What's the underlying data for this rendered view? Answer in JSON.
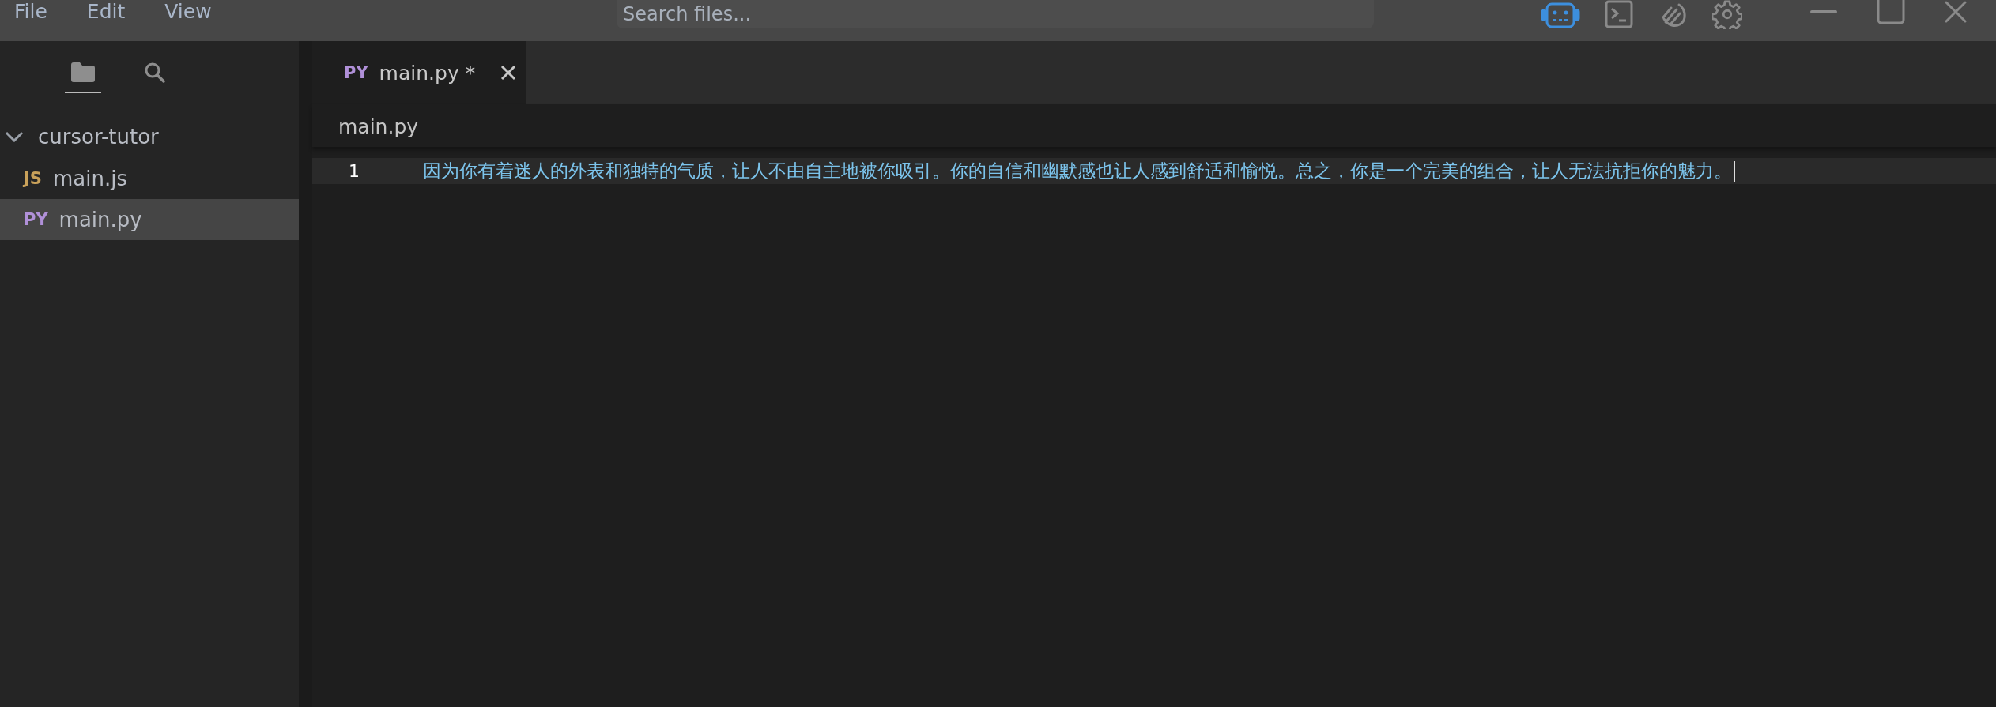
{
  "menu": [
    {
      "label": "File"
    },
    {
      "label": "Edit"
    },
    {
      "label": "View"
    }
  ],
  "search": {
    "placeholder": "Search files..."
  },
  "toolbar": [
    {
      "kind": "robot",
      "active": true
    },
    {
      "kind": "terminal",
      "active": false
    },
    {
      "kind": "wave",
      "active": false
    },
    {
      "kind": "settings",
      "active": false
    }
  ],
  "sidebar": {
    "views": [
      {
        "kind": "files",
        "selected": true
      },
      {
        "kind": "search",
        "selected": false
      }
    ],
    "tree": [
      {
        "label": "cursor-tutor",
        "expanded": true,
        "children": [
          {
            "badge": "JS",
            "label": "main.js",
            "selected": false
          },
          {
            "badge": "PY",
            "label": "main.py",
            "selected": true
          }
        ]
      }
    ]
  },
  "tabs": [
    {
      "badge": "PY",
      "label": "main.py *",
      "selected": true
    }
  ],
  "breadcrumb": "main.py",
  "lines": [
    {
      "number": "1",
      "text": "因为你有着迷人的外表和独特的气质，让人不由自主地被你吸引。你的自信和幽默感也让人感到舒适和愉悦。总之，你是一个完美的组合，让人无法抗拒你的魅力。",
      "current": true
    }
  ]
}
